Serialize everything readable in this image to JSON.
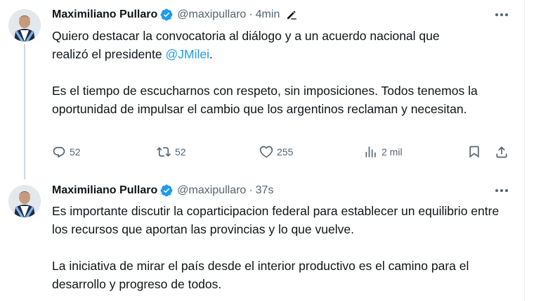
{
  "tweets": [
    {
      "author_name": "Maximiliano Pullaro",
      "handle": "@maxipullaro",
      "separator": "·",
      "time": "4min",
      "text_line1": "Quiero destacar la convocatoria al diálogo y a un acuerdo nacional que",
      "text_line2_prefix": "realizó el presidente ",
      "mention": "@JMilei",
      "mention_suffix": ".",
      "paragraph2": "Es el tiempo de escucharnos con respeto, sin imposiciones. Todos tenemos la oportunidad de impulsar el cambio que los argentinos reclaman y necesitan.",
      "replies": "52",
      "retweets": "52",
      "likes": "255",
      "views": "2 mil"
    },
    {
      "author_name": "Maximiliano Pullaro",
      "handle": "@maxipullaro",
      "separator": "·",
      "time": "37s",
      "paragraph1": "Es importante discutir la coparticipacion federal para establecer un equilibrio entre los recursos que aportan las provincias y lo que vuelve.",
      "paragraph2": "La iniciativa de mirar el país desde el interior productivo es el camino para el desarrollo y progreso de todos."
    }
  ],
  "icons": {
    "verified": "verified-badge-icon",
    "edit": "edit-pencil-icon",
    "more": "more-dots-icon",
    "reply": "reply-icon",
    "retweet": "retweet-icon",
    "like": "heart-icon",
    "views": "views-icon",
    "bookmark": "bookmark-icon",
    "share": "share-icon"
  },
  "colors": {
    "accent": "#1d9bf0",
    "text": "#0f1419",
    "muted": "#536471"
  }
}
